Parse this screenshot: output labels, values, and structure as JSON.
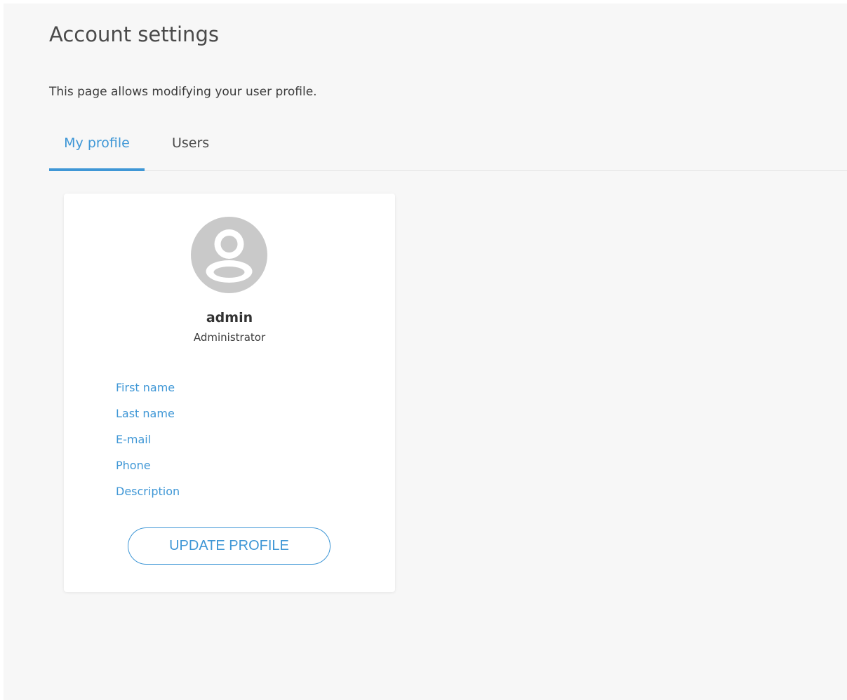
{
  "header": {
    "title": "Account settings",
    "description": "This page allows modifying your user profile."
  },
  "tabs": [
    {
      "label": "My profile",
      "active": true
    },
    {
      "label": "Users",
      "active": false
    }
  ],
  "profile": {
    "avatar_icon": "user-avatar-icon",
    "username": "admin",
    "role": "Administrator",
    "fields": [
      {
        "label": "First name"
      },
      {
        "label": "Last name"
      },
      {
        "label": "E-mail"
      },
      {
        "label": "Phone"
      },
      {
        "label": "Description"
      }
    ],
    "update_button_label": "UPDATE PROFILE"
  },
  "colors": {
    "accent": "#3f97d6",
    "background": "#f7f7f7",
    "card": "#ffffff",
    "avatar": "#c9c9c9"
  }
}
